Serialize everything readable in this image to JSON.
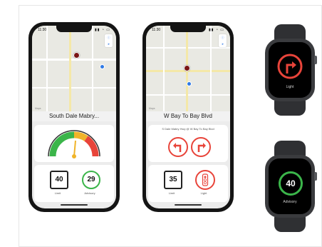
{
  "phone_left": {
    "status_time": "11:30",
    "road_name": "South Dale Mabry...",
    "map_legal": "Maps",
    "speed_limit": "40",
    "advisory_speed": "29",
    "limit_label": "Limit",
    "advisory_label": "Advisory"
  },
  "phone_middle": {
    "status_time": "11:30",
    "road_name": "W  Bay To Bay Blvd",
    "map_legal": "Maps",
    "intersection": "S Dale Mabry Hwy @ W Bay To Bay Blvd",
    "speed_limit": "35",
    "limit_label": "Limit",
    "light_label": "Light"
  },
  "watch_top": {
    "caption": "Light"
  },
  "watch_bottom": {
    "speed": "40",
    "caption": "Advisory"
  },
  "colors": {
    "signal_red": "#e8443a",
    "advisory_green": "#3bb54a",
    "gauge_yellow": "#f0b429",
    "map_blue": "#2f7ae5"
  }
}
